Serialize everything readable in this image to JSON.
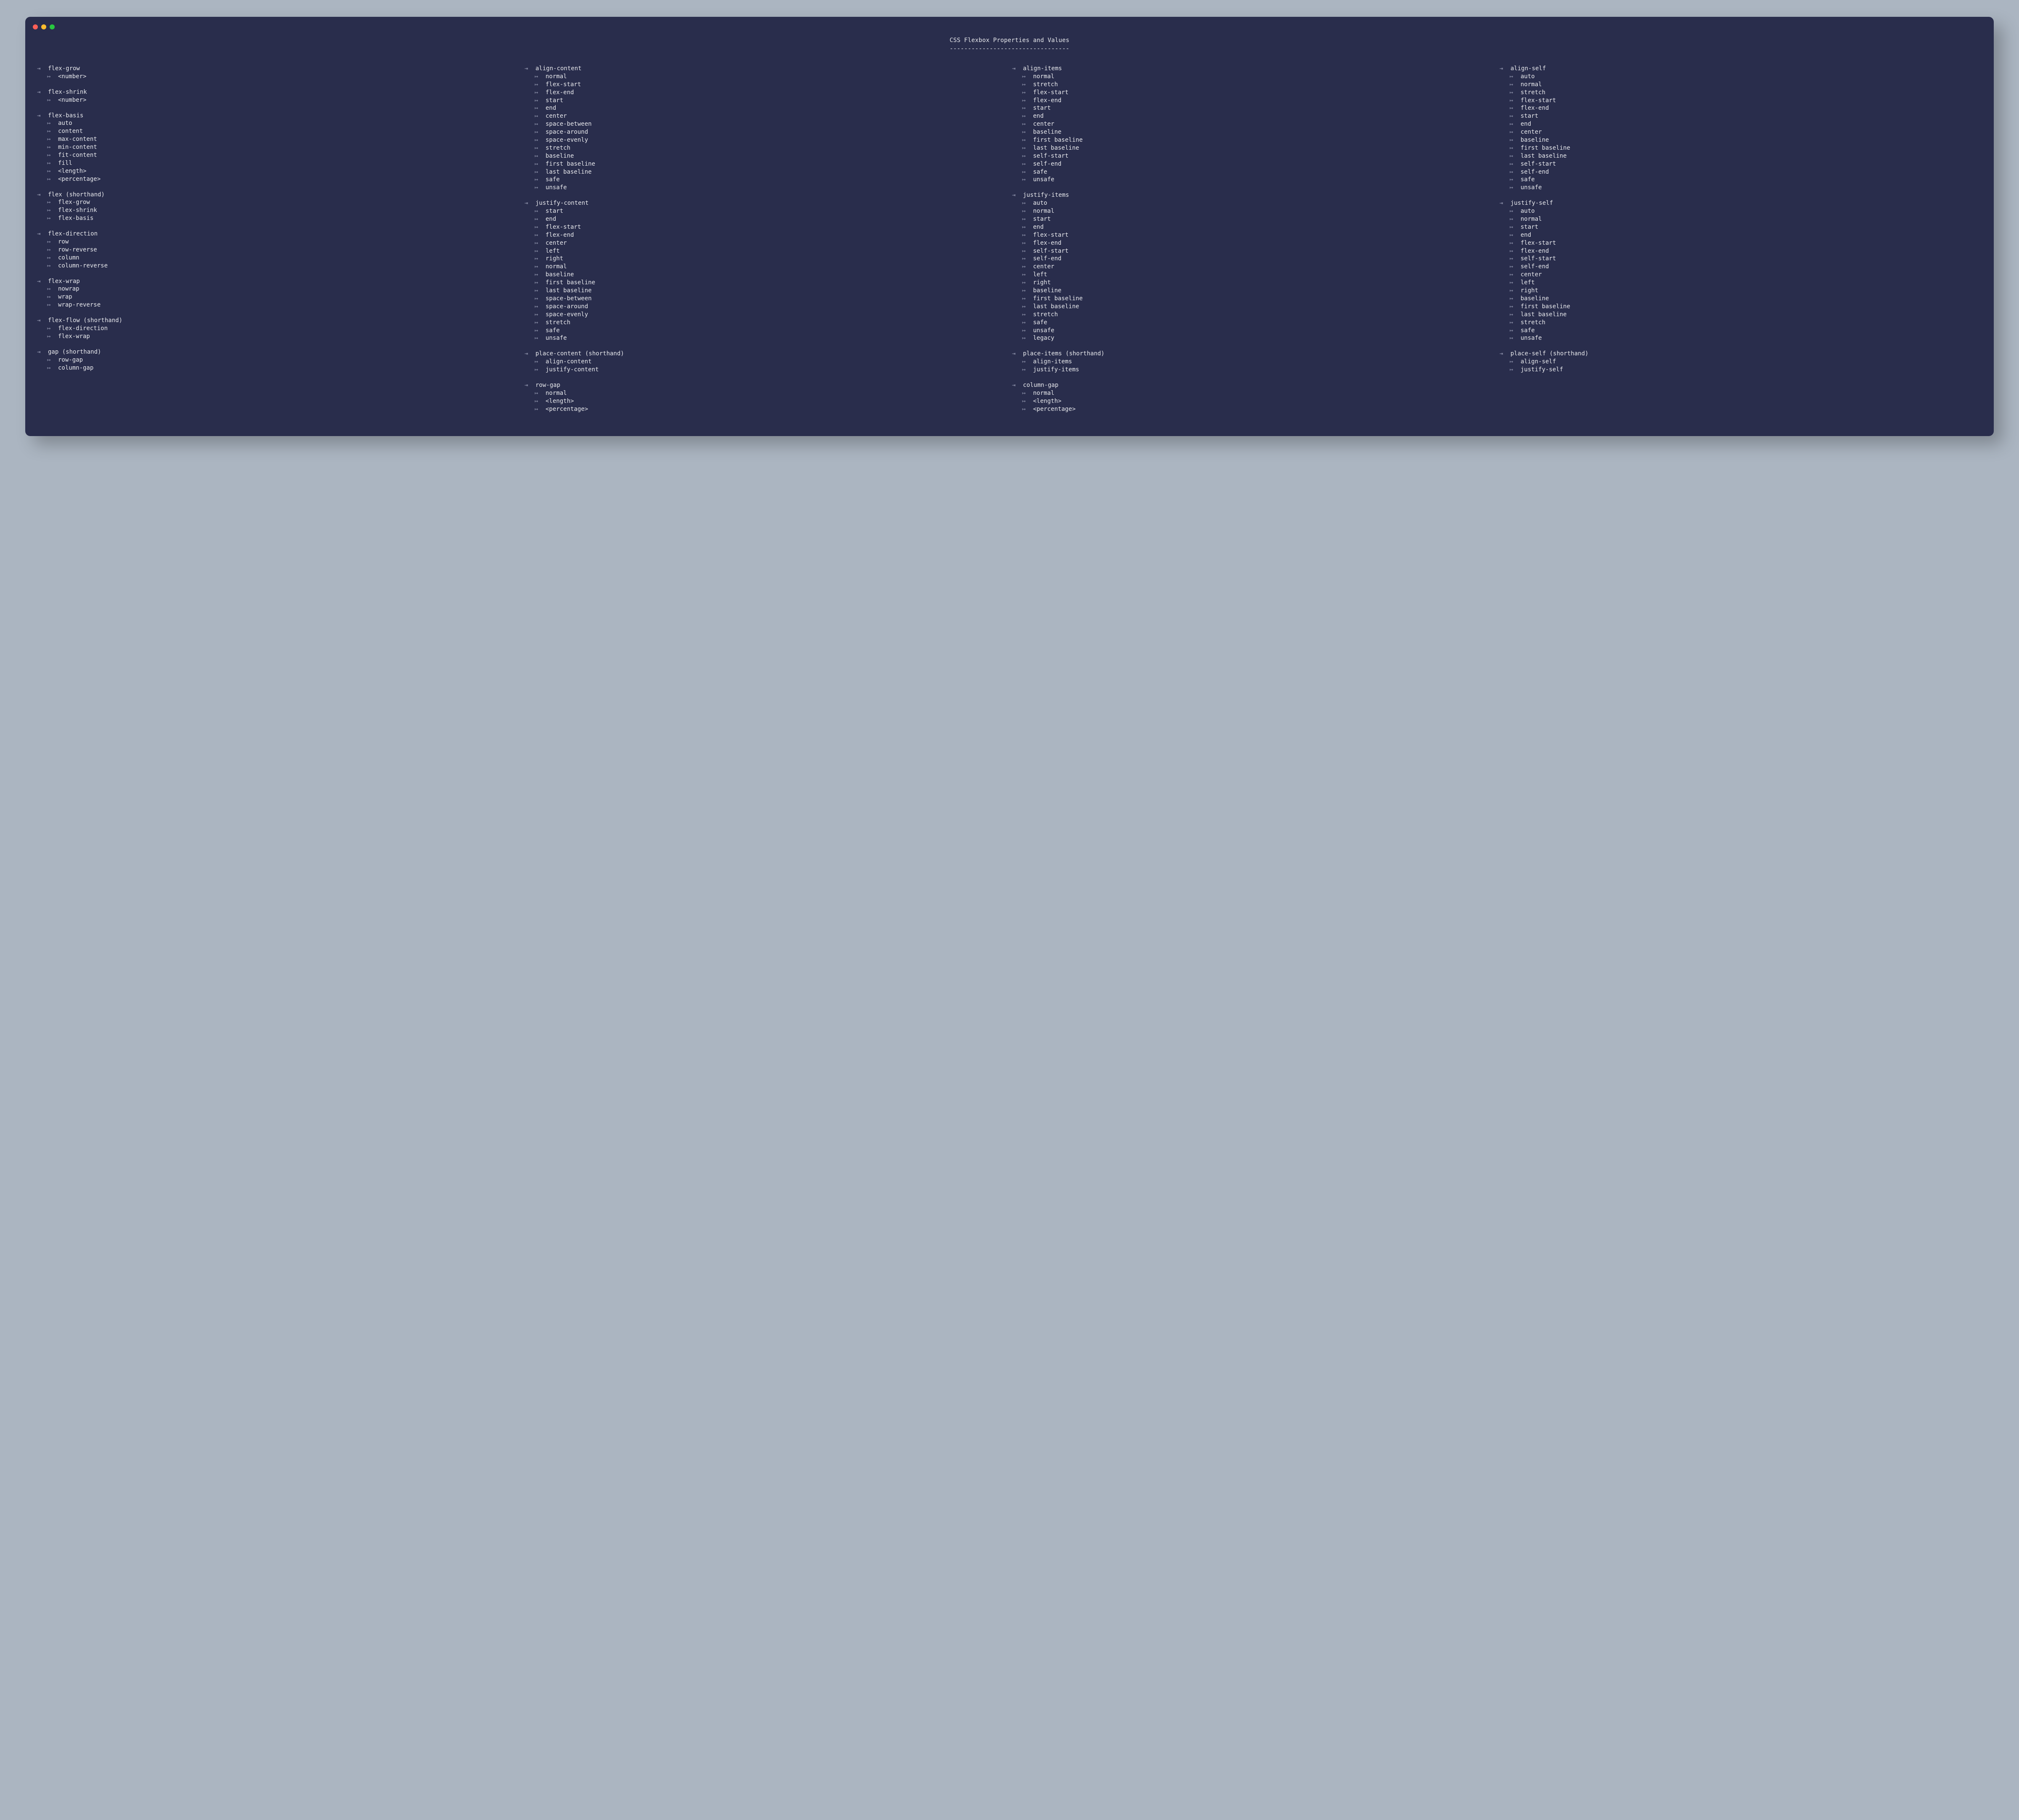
{
  "title": "CSS Flexbox Properties and Values",
  "underline": "---------------------------------",
  "glyph_prop": "⇥",
  "glyph_val": "↦",
  "columns": [
    [
      {
        "name": "flex-grow",
        "values": [
          "<number>"
        ]
      },
      {
        "name": "flex-shrink",
        "values": [
          "<number>"
        ]
      },
      {
        "name": "flex-basis",
        "values": [
          "auto",
          "content",
          "max-content",
          "min-content",
          "fit-content",
          "fill",
          "<length>",
          "<percentage>"
        ]
      },
      {
        "name": "flex (shorthand)",
        "values": [
          "flex-grow",
          "flex-shrink",
          "flex-basis"
        ]
      },
      {
        "name": "flex-direction",
        "values": [
          "row",
          "row-reverse",
          "column",
          "column-reverse"
        ]
      },
      {
        "name": "flex-wrap",
        "values": [
          "nowrap",
          "wrap",
          "wrap-reverse"
        ]
      },
      {
        "name": "flex-flow (shorthand)",
        "values": [
          "flex-direction",
          "flex-wrap"
        ]
      },
      {
        "name": "gap (shorthand)",
        "values": [
          "row-gap",
          "column-gap"
        ]
      }
    ],
    [
      {
        "name": "align-content",
        "values": [
          "normal",
          "flex-start",
          "flex-end",
          "start",
          "end",
          "center",
          "space-between",
          "space-around",
          "space-evenly",
          "stretch",
          "baseline",
          "first baseline",
          "last baseline",
          "safe",
          "unsafe"
        ]
      },
      {
        "name": "justify-content",
        "values": [
          "start",
          "end",
          "flex-start",
          "flex-end",
          "center",
          "left",
          "right",
          "normal",
          "baseline",
          "first baseline",
          "last baseline",
          "space-between",
          "space-around",
          "space-evenly",
          "stretch",
          "safe",
          "unsafe"
        ]
      },
      {
        "name": "place-content (shorthand)",
        "values": [
          "align-content",
          "justify-content"
        ]
      },
      {
        "name": "row-gap",
        "values": [
          "normal",
          "<length>",
          "<percentage>"
        ]
      }
    ],
    [
      {
        "name": "align-items",
        "values": [
          "normal",
          "stretch",
          "flex-start",
          "flex-end",
          "start",
          "end",
          "center",
          "baseline",
          "first baseline",
          "last baseline",
          "self-start",
          "self-end",
          "safe",
          "unsafe"
        ]
      },
      {
        "name": "justify-items",
        "values": [
          "auto",
          "normal",
          "start",
          "end",
          "flex-start",
          "flex-end",
          "self-start",
          "self-end",
          "center",
          "left",
          "right",
          "baseline",
          "first baseline",
          "last baseline",
          "stretch",
          "safe",
          "unsafe",
          "legacy"
        ]
      },
      {
        "name": "place-items (shorthand)",
        "values": [
          "align-items",
          "justify-items"
        ]
      },
      {
        "name": "column-gap",
        "values": [
          "normal",
          "<length>",
          "<percentage>"
        ]
      }
    ],
    [
      {
        "name": "align-self",
        "values": [
          "auto",
          "normal",
          "stretch",
          "flex-start",
          "flex-end",
          "start",
          "end",
          "center",
          "baseline",
          "first baseline",
          "last baseline",
          "self-start",
          "self-end",
          "safe",
          "unsafe"
        ]
      },
      {
        "name": "justify-self",
        "values": [
          "auto",
          "normal",
          "start",
          "end",
          "flex-start",
          "flex-end",
          "self-start",
          "self-end",
          "center",
          "left",
          "right",
          "baseline",
          "first baseline",
          "last baseline",
          "stretch",
          "safe",
          "unsafe"
        ]
      },
      {
        "name": "place-self (shorthand)",
        "values": [
          "align-self",
          "justify-self"
        ]
      }
    ]
  ]
}
